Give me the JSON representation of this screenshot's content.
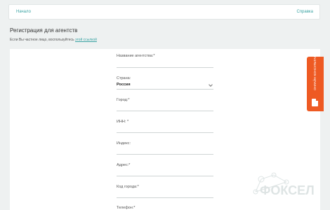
{
  "nav": {
    "home": "Начало",
    "help": "Справка"
  },
  "page": {
    "title": "Регистрация для агентств",
    "note_prefix": "Если Вы частное лицо, воспользуйтесь ",
    "note_link": "этой ссылкой"
  },
  "form": {
    "fields": [
      {
        "label": "Название агентства:*",
        "value": ""
      },
      {
        "label": "Страна:",
        "value": "Россия"
      },
      {
        "label": "Город:*",
        "value": ""
      },
      {
        "label": "ИНН: *",
        "value": ""
      },
      {
        "label": "Индекс:",
        "value": ""
      },
      {
        "label": "Адрес:*",
        "value": ""
      },
      {
        "label": "Код города:*",
        "value": ""
      },
      {
        "label": "Телефон:*",
        "value": ""
      }
    ]
  },
  "side_tab": {
    "label": "ОНЛАЙН КОНСУЛЬТАНТ",
    "icon": "document-icon",
    "color": "#ee5a23"
  },
  "watermark": {
    "text": "ФОКСЕЛ"
  },
  "colors": {
    "accent": "#3aa3a3",
    "background": "#eef1f1"
  }
}
